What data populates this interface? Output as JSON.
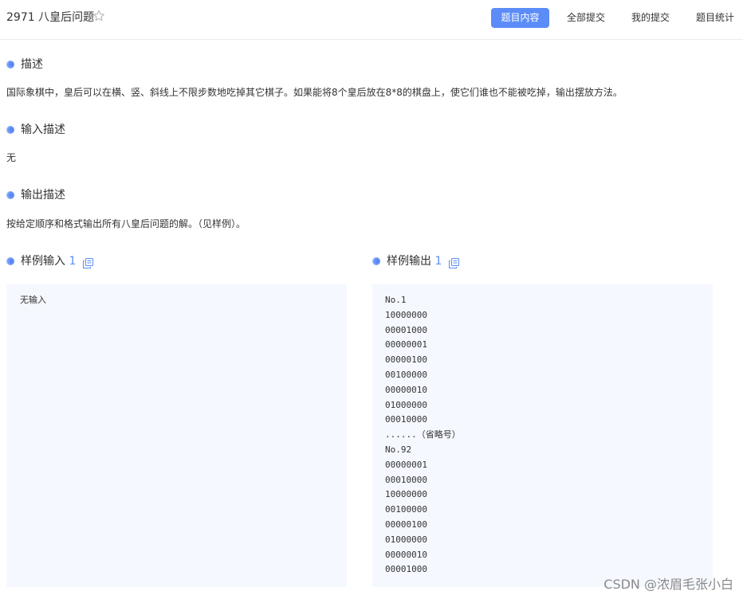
{
  "header": {
    "problem_title": "2971 八皇后问题",
    "tabs": [
      {
        "label": "题目内容",
        "active": true
      },
      {
        "label": "全部提交",
        "active": false
      },
      {
        "label": "我的提交",
        "active": false
      },
      {
        "label": "题目统计",
        "active": false
      }
    ]
  },
  "colors": {
    "accent": "#5b8cf7",
    "sample_background": "#f5f8fe"
  },
  "sections": {
    "description": {
      "heading": "描述",
      "text": "国际象棋中，皇后可以在横、竖、斜线上不限步数地吃掉其它棋子。如果能将8个皇后放在8*8的棋盘上，使它们谁也不能被吃掉，输出摆放方法。"
    },
    "input_description": {
      "heading": "输入描述",
      "text": "无"
    },
    "output_description": {
      "heading": "输出描述",
      "text": "按给定顺序和格式输出所有八皇后问题的解。（见样例）。"
    }
  },
  "samples": {
    "input": {
      "heading": "样例输入",
      "number": "1",
      "lines": [
        "无输入"
      ]
    },
    "output": {
      "heading": "样例输出",
      "number": "1",
      "lines": [
        "No.1",
        "10000000",
        "00001000",
        "00000001",
        "00000100",
        "00100000",
        "00000010",
        "01000000",
        "00010000",
        "......（省略号）",
        "No.92",
        "00000001",
        "00010000",
        "10000000",
        "00100000",
        "00000100",
        "01000000",
        "00000010",
        "00001000"
      ]
    }
  },
  "icons": {
    "favorite": "star-outline-icon",
    "copy": "copy-icon"
  },
  "watermark": "CSDN @浓眉毛张小白"
}
